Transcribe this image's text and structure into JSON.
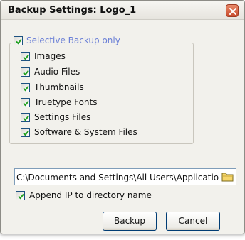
{
  "window": {
    "title": "Backup Settings: Logo_1"
  },
  "selective_backup": {
    "label": "Selective Backup only",
    "checked": true,
    "options": [
      {
        "label": "Images",
        "checked": true
      },
      {
        "label": "Audio Files",
        "checked": true
      },
      {
        "label": "Thumbnails",
        "checked": true
      },
      {
        "label": "Truetype Fonts",
        "checked": true
      },
      {
        "label": "Settings Files",
        "checked": true
      },
      {
        "label": "Software & System Files",
        "checked": true
      }
    ]
  },
  "path": {
    "value": "C:\\Documents and Settings\\All Users\\Applicatio"
  },
  "append_ip": {
    "label": "Append IP to directory name",
    "checked": true
  },
  "buttons": {
    "backup": "Backup",
    "cancel": "Cancel"
  },
  "icons": {
    "close": "close-icon",
    "folder": "folder-icon",
    "check": "checkmark-icon"
  },
  "colors": {
    "check": "#21a121",
    "legend_text": "#6a7fd6",
    "close": "#c84b2c"
  }
}
